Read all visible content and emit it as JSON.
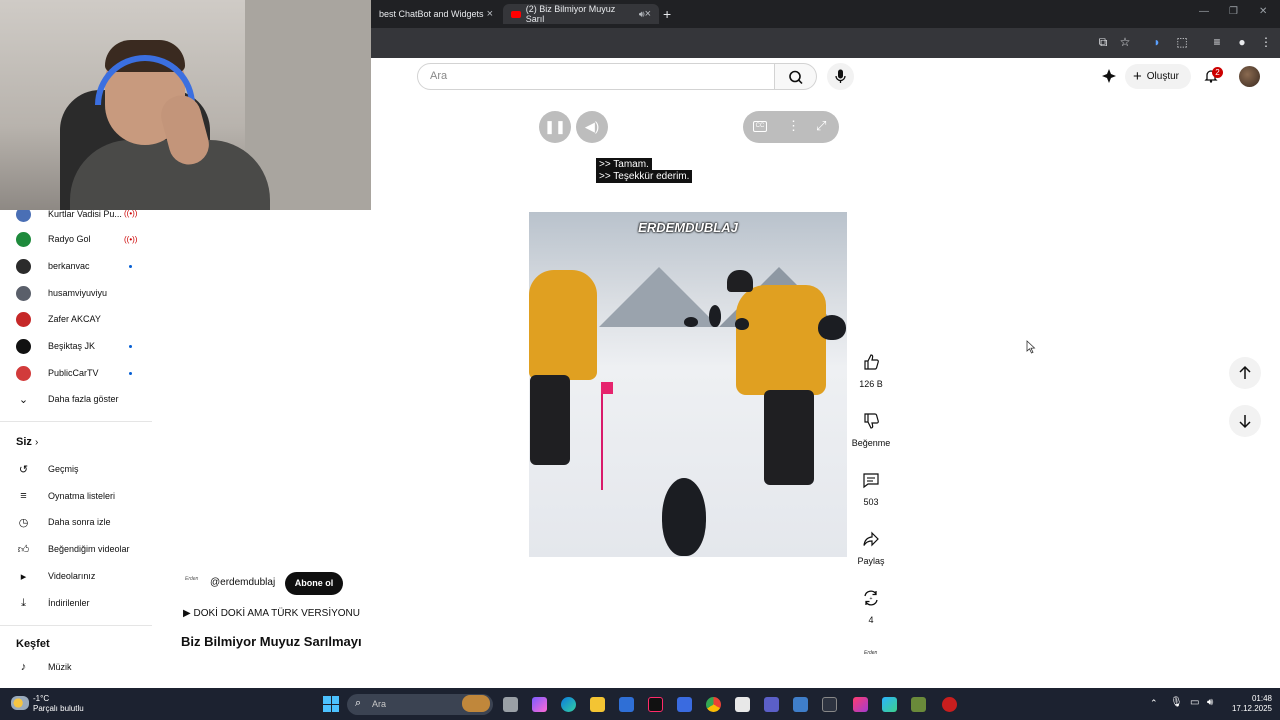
{
  "browser": {
    "tabs": [
      {
        "label": "best ChatBot and Widgets"
      },
      {
        "label": "(2) Biz Bilmiyor Muyuz Sarıl"
      }
    ]
  },
  "masthead": {
    "search_placeholder": "Ara",
    "create_label": "Oluştur",
    "notification_count": "2"
  },
  "sidebar": {
    "subscriptions": [
      {
        "label": "Kurtlar Vadisi Pu...",
        "avatar_color": "#4a6fb5",
        "status": "live"
      },
      {
        "label": "Radyo Gol",
        "avatar_color": "#1e8a3c",
        "status": "live"
      },
      {
        "label": "berkanvac",
        "avatar_color": "#2b2b2b",
        "status": "new"
      },
      {
        "label": "husamviyuviyu",
        "avatar_color": "#5a5f6a",
        "status": "none"
      },
      {
        "label": "Zafer AKCAY",
        "avatar_color": "#c62828",
        "status": "none"
      },
      {
        "label": "Beşiktaş JK",
        "avatar_color": "#111111",
        "status": "new"
      },
      {
        "label": "PublicCarTV",
        "avatar_color": "#d23b3b",
        "status": "new"
      }
    ],
    "show_more": "Daha fazla göster",
    "you_header": "Siz",
    "you_items": [
      {
        "label": "Geçmiş",
        "icon": "history-icon"
      },
      {
        "label": "Oynatma listeleri",
        "icon": "playlist-icon"
      },
      {
        "label": "Daha sonra izle",
        "icon": "watch-later-icon"
      },
      {
        "label": "Beğendiğim videolar",
        "icon": "thumb-up-icon"
      },
      {
        "label": "Videolarınız",
        "icon": "your-videos-icon"
      },
      {
        "label": "İndirilenler",
        "icon": "download-icon"
      }
    ],
    "explore_header": "Keşfet",
    "explore_items": [
      {
        "label": "Müzik",
        "icon": "music-icon"
      }
    ]
  },
  "player": {
    "captions": [
      ">> Tamam.",
      ">> Teşekkür ederim."
    ],
    "watermark": "ERDEMDUBLAJ"
  },
  "actions": {
    "like_count": "126 B",
    "dislike_label": "Beğenme",
    "comment_count": "503",
    "share_label": "Paylaş",
    "remix_count": "4",
    "small_logo": "Erden"
  },
  "short": {
    "channel_logo": "Erden",
    "channel_handle": "@erdemdublaj",
    "subscribe_label": "Abone ol",
    "music": "DOKİ DOKİ AMA TÜRK VERSİYONU",
    "title": "Biz Bilmiyor Muyuz Sarılmayı"
  },
  "taskbar": {
    "weather_temp": "-1°C",
    "weather_desc": "Parçalı bulutlu",
    "search_placeholder": "Ara",
    "time": "01:48",
    "date": "17.12.2025"
  }
}
